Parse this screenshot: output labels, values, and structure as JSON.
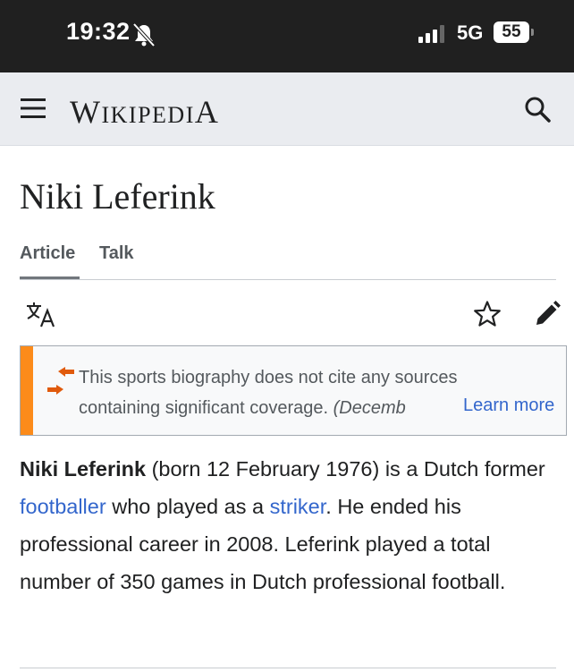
{
  "status_bar": {
    "time": "19:32",
    "network": "5G",
    "battery": "55",
    "icons": [
      "bell-slash-icon",
      "signal-icon",
      "battery-icon"
    ]
  },
  "header": {
    "logo_text_parts": [
      "W",
      "IKIPEDI",
      "A"
    ],
    "icons": [
      "menu-icon",
      "search-icon"
    ]
  },
  "page": {
    "title": "Niki Leferink",
    "tabs": [
      {
        "label": "Article",
        "active": true
      },
      {
        "label": "Talk",
        "active": false
      }
    ],
    "actions": [
      "translate-icon",
      "star-icon",
      "edit-icon"
    ]
  },
  "notice": {
    "line1": "This sports biography does not cite any sources",
    "line2": "containing significant coverage.",
    "date": "(Decemb",
    "learn_more": "Learn more",
    "accent_color": "#fc8b1a"
  },
  "article": {
    "subject": "Niki Leferink",
    "part1": " (born 12 February 1976) is a Dutch former ",
    "link1": "footballer",
    "part2": " who played as a ",
    "link2": "striker",
    "part3": ". He ended his professional career in 2008. Leferink played a total number of 350 games in Dutch professional football.",
    "link_color": "#3366cc"
  }
}
